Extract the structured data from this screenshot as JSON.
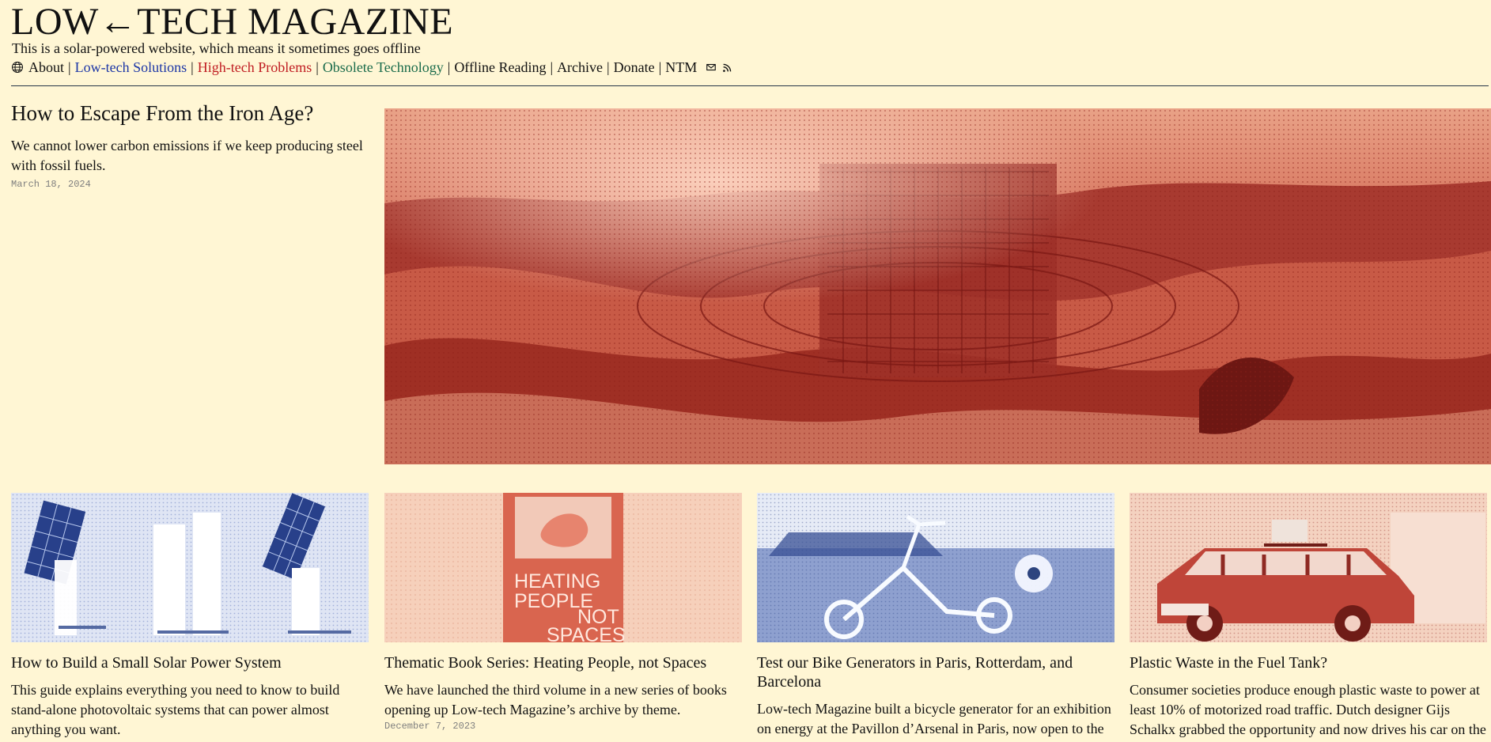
{
  "site": {
    "logo": "LOW←TECH MAGAZINE",
    "tagline": "This is a solar-powered website, which means it sometimes goes offline"
  },
  "nav": {
    "items": [
      {
        "label": "About",
        "tone": "default"
      },
      {
        "label": "Low-tech Solutions",
        "tone": "blue"
      },
      {
        "label": "High-tech Problems",
        "tone": "red"
      },
      {
        "label": "Obsolete Technology",
        "tone": "green"
      },
      {
        "label": "Offline Reading",
        "tone": "default"
      },
      {
        "label": "Archive",
        "tone": "default"
      },
      {
        "label": "Donate",
        "tone": "default"
      },
      {
        "label": "NTM",
        "tone": "default"
      }
    ],
    "separator": "|",
    "icons": [
      "globe-icon",
      "mail-icon",
      "rss-icon"
    ]
  },
  "hero": {
    "title": "How to Escape From the Iron Age?",
    "summary": "We cannot lower carbon emissions if we keep producing steel with fossil fuels.",
    "date": "March 18, 2024",
    "image_name": "iron-age-hero-image"
  },
  "cards": [
    {
      "title": "How to Build a Small Solar Power System",
      "summary": "This guide explains everything you need to know to build stand-alone photovoltaic systems that can power almost anything you want.",
      "date": "",
      "image_name": "solar-power-system-image"
    },
    {
      "title": "Thematic Book Series: Heating People, not Spaces",
      "summary": "We have launched the third volume in a new series of books opening up Low-tech Magazine’s archive by theme.",
      "date": "December 7, 2023",
      "image_name": "heating-people-book-image",
      "image_text": "HEATING PEOPLE NOT SPACES"
    },
    {
      "title": "Test our Bike Generators in Paris, Rotterdam, and Barcelona",
      "summary": "Low-tech Magazine built a bicycle generator for an exhibition on energy at the Pavillon d’Arsenal in Paris, now open to the",
      "date": "",
      "image_name": "bike-generator-image"
    },
    {
      "title": "Plastic Waste in the Fuel Tank?",
      "summary": "Consumer societies produce enough plastic waste to power at least 10% of motorized road traffic. Dutch designer Gijs Schalkx grabbed the opportunity and now drives his car on the",
      "date": "",
      "image_name": "plastic-fuel-car-image"
    }
  ],
  "colors": {
    "background": "#fff6d4",
    "text": "#111111",
    "blue": "#1c36a6",
    "red": "#c01d22",
    "green": "#1a6b4b",
    "date": "#7f7f7f",
    "rule": "#263647"
  }
}
